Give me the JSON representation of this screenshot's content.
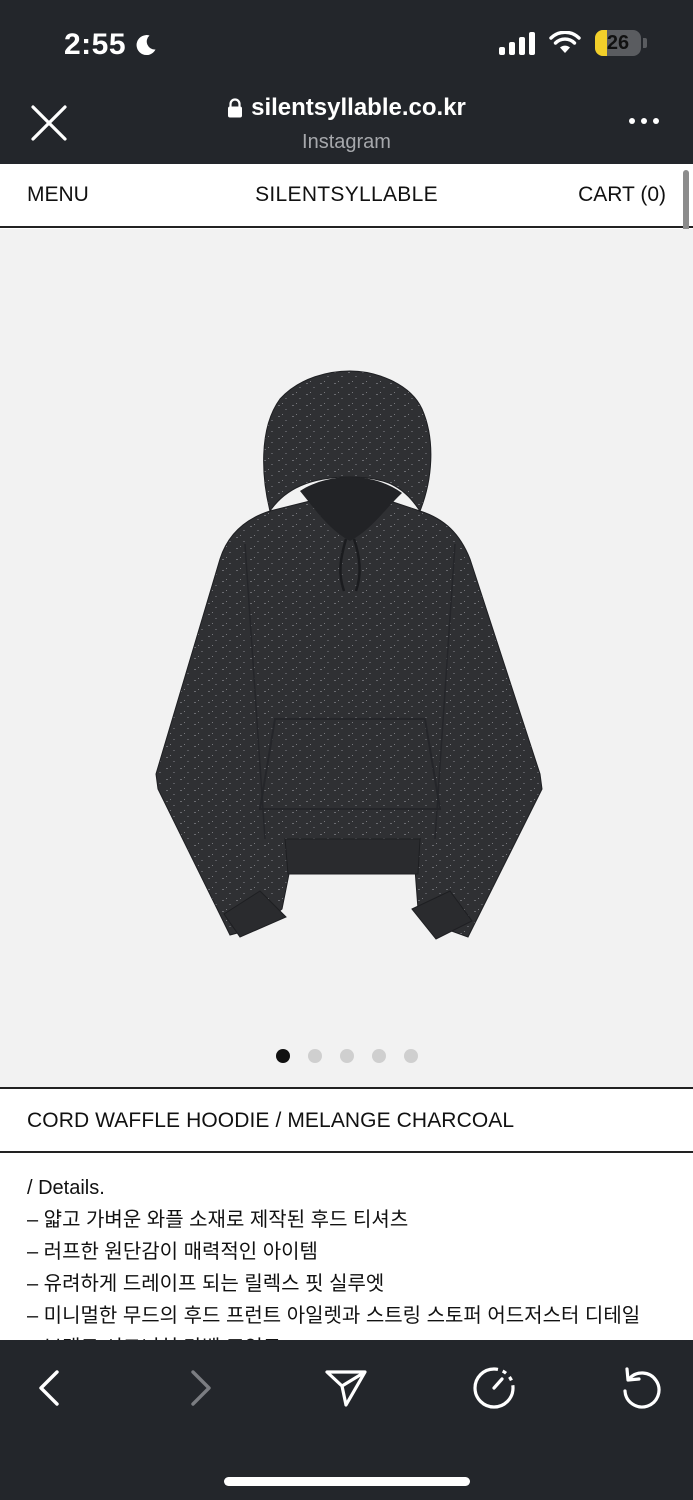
{
  "status": {
    "time": "2:55",
    "battery": "26",
    "battery_level": 0.26
  },
  "browser": {
    "url": "silentsyllable.co.kr",
    "source": "Instagram"
  },
  "site": {
    "menu_label": "MENU",
    "brand": "SILENTSYLLABLE",
    "cart_label": "CART (0)"
  },
  "product": {
    "title": "CORD WAFFLE HOODIE / MELANGE CHARCOAL",
    "image_count": 5,
    "active_image": 1,
    "details": [
      "/ Details.",
      "– 얇고 가벼운 와플 소재로 제작된 후드 티셔츠",
      "– 러프한 원단감이 매력적인 아이템",
      "– 유려하게 드레이프 되는 릴렉스 핏 실루엣",
      "– 미니멀한 무드의 후드 프런트 아일렛과 스트링 스토퍼 어드저스터 디테일",
      "– 브랜드 시그니처 라벨 포인트"
    ]
  },
  "colors": {
    "chrome": "#23262b",
    "image_bg": "#f2f2f2",
    "hoodie": "#2f3033"
  },
  "icons": {
    "close": "close-icon",
    "lock": "lock-icon",
    "more": "more-icon",
    "back": "back-icon",
    "forward": "forward-icon",
    "share": "share-icon",
    "speed": "speed-icon",
    "reload": "reload-icon"
  }
}
